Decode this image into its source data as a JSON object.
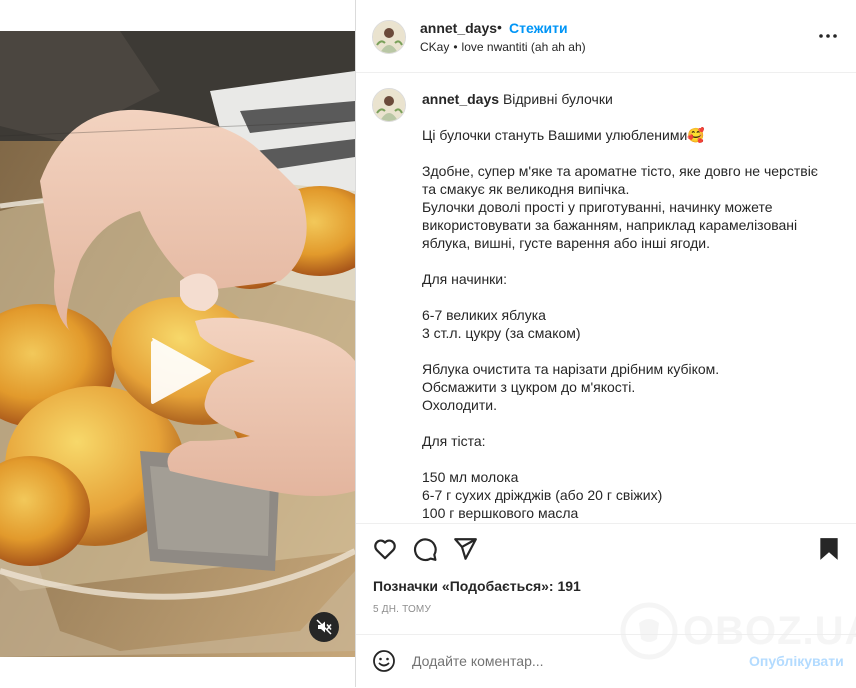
{
  "post": {
    "username": "annet_days",
    "separator": "•",
    "follow_label": "Стежити",
    "audio_artist": "CKay",
    "audio_dot": "•",
    "audio_track": "love nwantiti (ah ah ah)"
  },
  "caption": {
    "username": "annet_days",
    "title": "Відривні булочки",
    "lines": [
      "Ці булочки стануть Вашими улюбленими🥰",
      "",
      "Здобне, супер м'яке та ароматне тісто, яке довго не черствіє та смакує як великодня випічка.",
      "Булочки доволі прості у приготуванні, начинку можете використовувати за бажанням, наприклад карамелізовані яблука, вишні, густе варення або інші ягоди.",
      "",
      "Для начинки:",
      "",
      "6-7 великих яблука",
      "3 ст.л. цукру (за смаком)",
      "",
      "Яблука очистита та нарізати дрібним кубіком.",
      "Обсмажити з цукром до м'якості.",
      "Охолодити.",
      "",
      "Для тіста:",
      "",
      "150 мл молока",
      "6-7 г сухих дріжджів (або 20 г свіжих)",
      "100 г вершкового масла"
    ]
  },
  "stats": {
    "likes_text": "Позначки «Подобається»: 191",
    "time_ago": "5 ДН. ТОМУ"
  },
  "comment": {
    "placeholder": "Додайте коментар...",
    "post_label": "Опублікувати"
  },
  "watermark": {
    "text": "OBOZ.UA"
  },
  "icons": {
    "like": "heart-icon",
    "comment": "comment-icon",
    "share": "send-icon",
    "save": "bookmark-icon",
    "more": "more-dots-icon",
    "emoji": "emoji-icon",
    "play": "play-icon",
    "mute": "mute-icon"
  },
  "colors": {
    "follow_blue": "#0095f6",
    "post_disabled": "#b3dbff",
    "muted_text": "#8e8e8e"
  }
}
